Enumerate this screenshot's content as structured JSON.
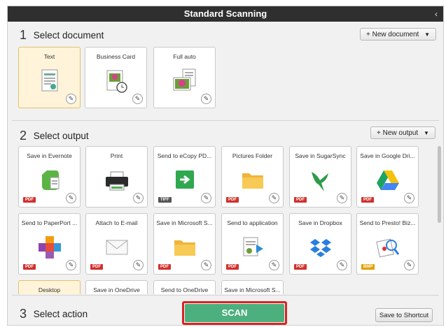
{
  "window": {
    "title": "Standard Scanning",
    "collapse_glyph": "‹"
  },
  "section1": {
    "number": "1",
    "title": "Select document",
    "new_button": "New document",
    "tiles": [
      {
        "label": "Text",
        "icon": "text-document-icon",
        "selected": true
      },
      {
        "label": "Business Card",
        "icon": "business-card-icon",
        "selected": false
      },
      {
        "label": "Full auto",
        "icon": "full-auto-icon",
        "selected": false
      }
    ]
  },
  "section2": {
    "number": "2",
    "title": "Select output",
    "new_button": "New output",
    "tiles": [
      {
        "label": "Save in Evernote",
        "icon": "evernote-icon",
        "badge": "PDF"
      },
      {
        "label": "Print",
        "icon": "printer-icon",
        "badge": ""
      },
      {
        "label": "Send to eCopy PD...",
        "icon": "ecopy-icon",
        "badge": "TIFF"
      },
      {
        "label": "Pictures Folder",
        "icon": "folder-icon",
        "badge": "PDF"
      },
      {
        "label": "Save in SugarSync",
        "icon": "sugarsync-icon",
        "badge": "PDF"
      },
      {
        "label": "Save in Google Dri...",
        "icon": "google-drive-icon",
        "badge": "PDF"
      },
      {
        "label": "Send to PaperPort ...",
        "icon": "paperport-icon",
        "badge": "PDF"
      },
      {
        "label": "Attach to E-mail",
        "icon": "email-icon",
        "badge": "PDF"
      },
      {
        "label": "Save in Microsoft S...",
        "icon": "folder-icon",
        "badge": "PDF"
      },
      {
        "label": "Send to application",
        "icon": "send-to-application-icon",
        "badge": "PDF"
      },
      {
        "label": "Save in Dropbox",
        "icon": "dropbox-icon",
        "badge": "PDF"
      },
      {
        "label": "Send to Presto! Biz...",
        "icon": "presto-biz-icon",
        "badge": "BMP"
      }
    ],
    "partial_tiles": [
      {
        "label": "Desktop",
        "selected": true
      },
      {
        "label": "Save in OneDrive",
        "selected": false
      },
      {
        "label": "Send to OneDrive",
        "selected": false
      },
      {
        "label": "Save in Microsoft S...",
        "selected": false
      }
    ]
  },
  "section3": {
    "number": "3",
    "title": "Select action",
    "scan_button": "SCAN",
    "shortcut_button": "Save to Shortcut"
  }
}
